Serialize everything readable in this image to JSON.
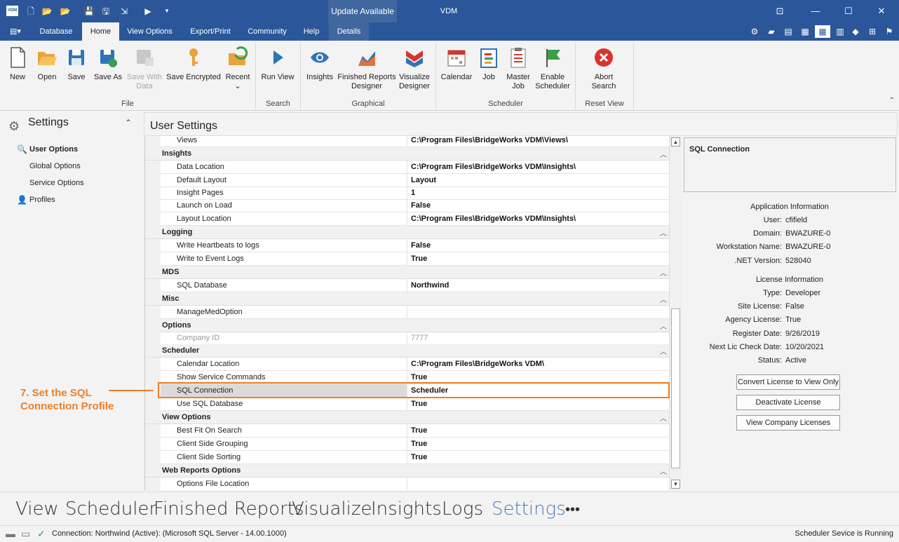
{
  "titlebar": {
    "app_logo": "VDM",
    "update": "Update Available",
    "title": "VDM"
  },
  "tabs": [
    {
      "label": "Database"
    },
    {
      "label": "Home"
    },
    {
      "label": "View Options"
    },
    {
      "label": "Export/Print"
    },
    {
      "label": "Community"
    },
    {
      "label": "Help"
    },
    {
      "label": "Details"
    }
  ],
  "ribbon": {
    "file": {
      "new": "New",
      "open": "Open",
      "save": "Save",
      "saveas": "Save As",
      "savewith": "Save With",
      "savewith2": "Data",
      "saveenc": "Save Encrypted",
      "recent": "Recent",
      "group": "File"
    },
    "search": {
      "run": "Run View",
      "group": "Search"
    },
    "graphical": {
      "insights": "Insights",
      "frd1": "Finished Reports",
      "frd2": "Designer",
      "vis1": "Visualize",
      "vis2": "Designer",
      "group": "Graphical"
    },
    "scheduler": {
      "calendar": "Calendar",
      "job": "Job",
      "master1": "Master",
      "master2": "Job",
      "enable1": "Enable",
      "enable2": "Scheduler",
      "group": "Scheduler"
    },
    "reset": {
      "abort1": "Abort",
      "abort2": "Search",
      "group": "Reset View"
    }
  },
  "left": {
    "title": "Settings",
    "items": [
      "User Options",
      "Global Options",
      "Service Options",
      "Profiles"
    ]
  },
  "content": {
    "title": "User Settings"
  },
  "grid": {
    "top_row": {
      "name": "Views",
      "value": "C:\\Program Files\\BridgeWorks VDM\\Views\\"
    },
    "categories": [
      {
        "name": "Insights",
        "rows": [
          {
            "name": "Data Location",
            "value": "C:\\Program Files\\BridgeWorks VDM\\Insights\\"
          },
          {
            "name": "Default Layout",
            "value": "Layout"
          },
          {
            "name": "Insight Pages",
            "value": "1"
          },
          {
            "name": "Launch on Load",
            "value": "False"
          },
          {
            "name": "Layout Location",
            "value": "C:\\Program Files\\BridgeWorks VDM\\Insights\\"
          }
        ]
      },
      {
        "name": "Logging",
        "rows": [
          {
            "name": "Write Heartbeats to logs",
            "value": "False"
          },
          {
            "name": "Write to Event Logs",
            "value": "True"
          }
        ]
      },
      {
        "name": "MDS",
        "rows": [
          {
            "name": "SQL Database",
            "value": "Northwind"
          }
        ]
      },
      {
        "name": "Misc",
        "rows": [
          {
            "name": "ManageMedOption",
            "value": ""
          }
        ]
      },
      {
        "name": "Options",
        "rows": [
          {
            "name": "Company ID",
            "value": "7777"
          }
        ]
      },
      {
        "name": "Scheduler",
        "rows": [
          {
            "name": "Calendar Location",
            "value": "C:\\Program Files\\BridgeWorks VDM\\"
          },
          {
            "name": "Show Service Commands",
            "value": "True"
          },
          {
            "name": "SQL Connection",
            "value": "Scheduler"
          },
          {
            "name": "Use SQL Database",
            "value": "True"
          }
        ]
      },
      {
        "name": "View Options",
        "rows": [
          {
            "name": "Best Fit On Search",
            "value": "True"
          },
          {
            "name": "Client Side Grouping",
            "value": "True"
          },
          {
            "name": "Client Side Sorting",
            "value": "True"
          }
        ]
      },
      {
        "name": "Web Reports Options",
        "rows": [
          {
            "name": "Options File Location",
            "value": ""
          }
        ]
      }
    ]
  },
  "right": {
    "desc_title": "SQL Connection",
    "app_info": "Application Information",
    "user_l": "User:",
    "user": "cfifield",
    "domain_l": "Domain:",
    "domain": "BWAZURE-0",
    "ws_l": "Workstation Name:",
    "ws": "BWAZURE-0",
    "net_l": ".NET Version:",
    "net": "528040",
    "lic_info": "License Information",
    "type_l": "Type:",
    "type": "Developer",
    "site_l": "Site License:",
    "site": "False",
    "agency_l": "Agency License:",
    "agency": "True",
    "reg_l": "Register Date:",
    "reg": "9/26/2019",
    "next_l": "Next Lic Check Date:",
    "next": "10/20/2021",
    "status_l": "Status:",
    "status": "Active",
    "btn1": "Convert License to View Only",
    "btn2": "Deactivate License",
    "btn3": "View Company Licenses"
  },
  "annotation": {
    "line1": "7. Set the SQL",
    "line2": "Connection Profile"
  },
  "nav": [
    "View",
    "Scheduler",
    "Finished Reports",
    "Visualize",
    "Insights",
    "Logs",
    "Settings",
    "•••"
  ],
  "status": {
    "text": "Connection: Northwind (Active): (Microsoft SQL Server - 14.00.1000)",
    "right": "Scheduler Sevice is Running"
  },
  "colors": {
    "title": "#2b579a",
    "accent": "#f07e26",
    "nav_active": "#4a7bb7"
  }
}
